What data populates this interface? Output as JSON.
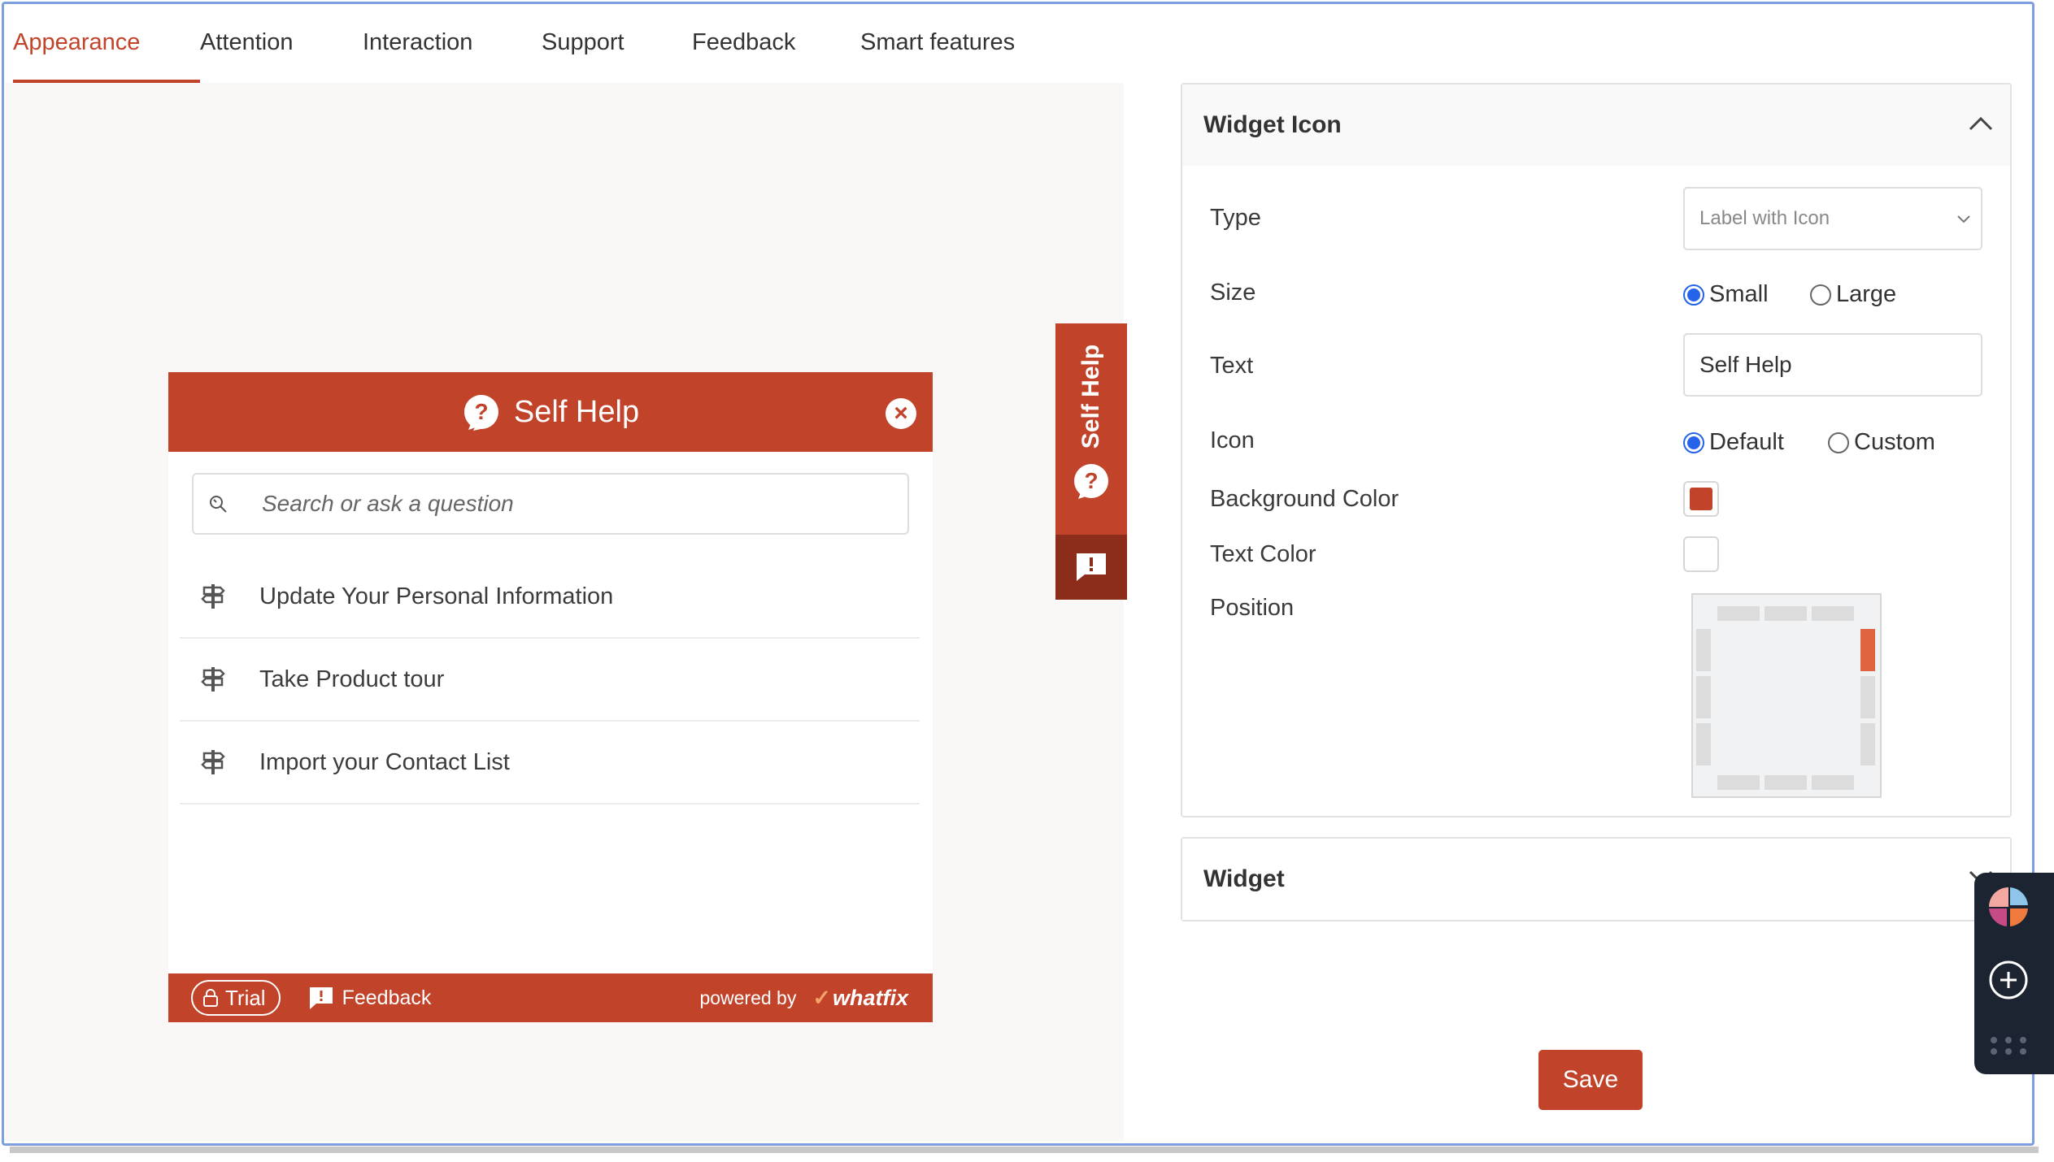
{
  "tabs": [
    {
      "label": "Appearance",
      "active": true
    },
    {
      "label": "Attention",
      "active": false
    },
    {
      "label": "Interaction",
      "active": false
    },
    {
      "label": "Support",
      "active": false
    },
    {
      "label": "Feedback",
      "active": false
    },
    {
      "label": "Smart features",
      "active": false
    }
  ],
  "preview": {
    "panel_title": "Self Help",
    "search_placeholder": "Search or ask a question",
    "items": [
      {
        "label": "Update Your Personal Information",
        "icon": "signpost-icon"
      },
      {
        "label": "Take Product tour",
        "icon": "signpost-icon"
      },
      {
        "label": "Import your Contact List",
        "icon": "signpost-icon"
      }
    ],
    "footer": {
      "trial_label": "Trial",
      "feedback_label": "Feedback",
      "powered_by": "powered by",
      "brand": "whatfix"
    },
    "side_tab_label": "Self Help",
    "accent_color": "#c1432a"
  },
  "widget_icon": {
    "section_title": "Widget Icon",
    "type_label": "Type",
    "type_value": "Label with Icon",
    "size_label": "Size",
    "size_options": [
      "Small",
      "Large"
    ],
    "size_selected": "Small",
    "text_label": "Text",
    "text_value": "Self Help",
    "icon_label": "Icon",
    "icon_options": [
      "Default",
      "Custom"
    ],
    "icon_selected": "Default",
    "bg_color_label": "Background Color",
    "bg_color": "#c1432a",
    "text_color_label": "Text Color",
    "text_color": "#ffffff",
    "position_label": "Position",
    "position_selected": "right-top"
  },
  "widget": {
    "section_title": "Widget"
  },
  "actions": {
    "save_label": "Save"
  }
}
